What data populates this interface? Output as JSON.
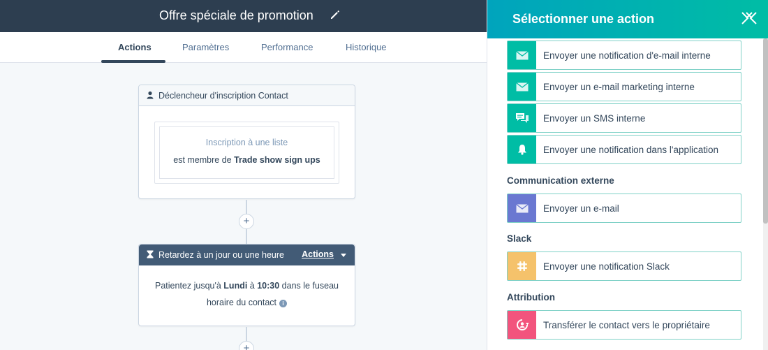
{
  "header": {
    "title": "Offre spéciale de promotion",
    "edit_icon": "pencil-icon"
  },
  "tabs": [
    {
      "label": "Actions",
      "active": true
    },
    {
      "label": "Paramètres",
      "active": false
    },
    {
      "label": "Performance",
      "active": false
    },
    {
      "label": "Historique",
      "active": false
    }
  ],
  "workflow": {
    "trigger": {
      "title": "Déclencheur d'inscription Contact",
      "line1": "Inscription à une liste",
      "line2_prefix": "est membre de ",
      "line2_bold": "Trade show sign ups"
    },
    "delay": {
      "title": "Retardez à un jour ou une heure",
      "actions_label": "Actions",
      "body_prefix": "Patientez jusqu'à ",
      "body_day": "Lundi",
      "body_mid": " à ",
      "body_time": "10:30",
      "body_suffix": " dans le fuseau",
      "body_line2": "horaire du contact"
    },
    "plus_label": "+"
  },
  "panel": {
    "title": "Sélectionner une action",
    "internal_actions": [
      {
        "label": "Envoyer une notification d'e-mail interne",
        "icon": "envelope-icon"
      },
      {
        "label": "Envoyer un e-mail marketing interne",
        "icon": "envelope-icon"
      },
      {
        "label": "Envoyer un SMS interne",
        "icon": "chat-bubbles-icon"
      },
      {
        "label": "Envoyer une notification dans l'application",
        "icon": "bell-icon"
      }
    ],
    "external_title": "Communication externe",
    "external_actions": [
      {
        "label": "Envoyer un e-mail",
        "icon": "envelope-icon"
      }
    ],
    "slack_title": "Slack",
    "slack_actions": [
      {
        "label": "Envoyer une notification Slack",
        "icon": "slack-icon"
      }
    ],
    "attribution_title": "Attribution",
    "attribution_actions": [
      {
        "label": "Transférer le contact vers le propriétaire",
        "icon": "rotate-user-icon"
      }
    ]
  },
  "colors": {
    "header_bg": "#2d3e50",
    "panel_gradient_start": "#00a4bd",
    "panel_gradient_end": "#00bda5",
    "internal_icon_bg": "#00bda5",
    "external_icon_bg": "#6a78d1",
    "slack_icon_bg": "#f5c26b",
    "attribution_icon_bg": "#f2547d",
    "delay_head_bg": "#425b76"
  }
}
